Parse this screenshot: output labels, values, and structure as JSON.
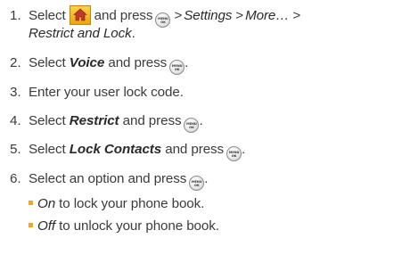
{
  "steps": [
    {
      "number": "1.",
      "select": "Select",
      "and_press": "and press",
      "path": [
        "Settings",
        "More…"
      ],
      "path_last": "Restrict and Lock",
      "suffix": "."
    },
    {
      "number": "2.",
      "select": "Select",
      "item": "Voice",
      "and_press": "and press",
      "suffix": "."
    },
    {
      "number": "3.",
      "text": "Enter your user lock code."
    },
    {
      "number": "4.",
      "select": "Select",
      "item": "Restrict",
      "and_press": "and press",
      "suffix": "."
    },
    {
      "number": "5.",
      "select": "Select",
      "item": "Lock Contacts",
      "and_press": "and press",
      "suffix": "."
    },
    {
      "number": "6.",
      "text": "Select an option and press",
      "suffix": "."
    }
  ],
  "options": [
    {
      "label": "On",
      "text": " to lock your phone book."
    },
    {
      "label": "Off",
      "text": " to unlock your phone book."
    }
  ],
  "key_label_top": "MENU",
  "key_label_bottom": "OK",
  "separator": ">",
  "colors": {
    "text": "#3b3b3b",
    "bullet": "#f5a623",
    "home_button": "#f0b020"
  },
  "icons": {
    "home": "home-icon",
    "menu_key": "menu-ok-key-icon"
  }
}
